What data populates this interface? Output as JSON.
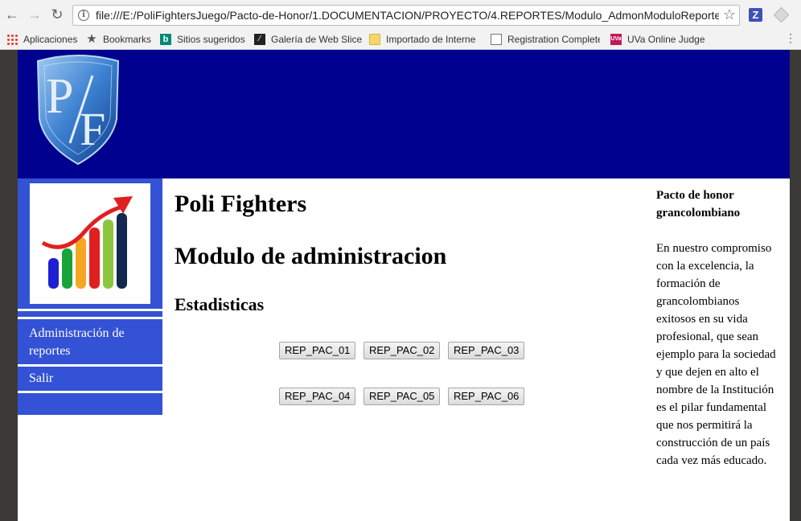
{
  "browser": {
    "url": "file:///E:/PoliFightersJuego/Pacto-de-Honor/1.DOCUMENTACION/PROYECTO/4.REPORTES/Modulo_AdmonModuloReportes.h",
    "bookmarks": [
      "Aplicaciones",
      "Bookmarks",
      "Sitios sugeridos",
      "Galería de Web Slice",
      "Importado de Interne",
      "Registration Complete",
      "UVa Online Judge"
    ]
  },
  "header": {
    "logo_letters": [
      "P",
      "F"
    ],
    "bg_color": "#00008f"
  },
  "sidebar": {
    "items": [
      "Administración de reportes",
      "Salir"
    ],
    "bg_color": "#3452d6"
  },
  "main": {
    "title": "Poli Fighters",
    "subtitle": "Modulo de administracion",
    "section": "Estadisticas",
    "buttons_row1": [
      "REP_PAC_01",
      "REP_PAC_02",
      "REP_PAC_03"
    ],
    "buttons_row2": [
      "REP_PAC_04",
      "REP_PAC_05",
      "REP_PAC_06"
    ]
  },
  "aside": {
    "title": "Pacto de honor grancolombiano",
    "text": "En nuestro compromiso con la excelencia, la formación de grancolombianos exitosos en su vida profesional, que sean ejemplo para la sociedad y que dejen en alto el nombre de la Institución es el pilar fundamental que nos permitirá la construcción de un país cada vez más educado."
  }
}
